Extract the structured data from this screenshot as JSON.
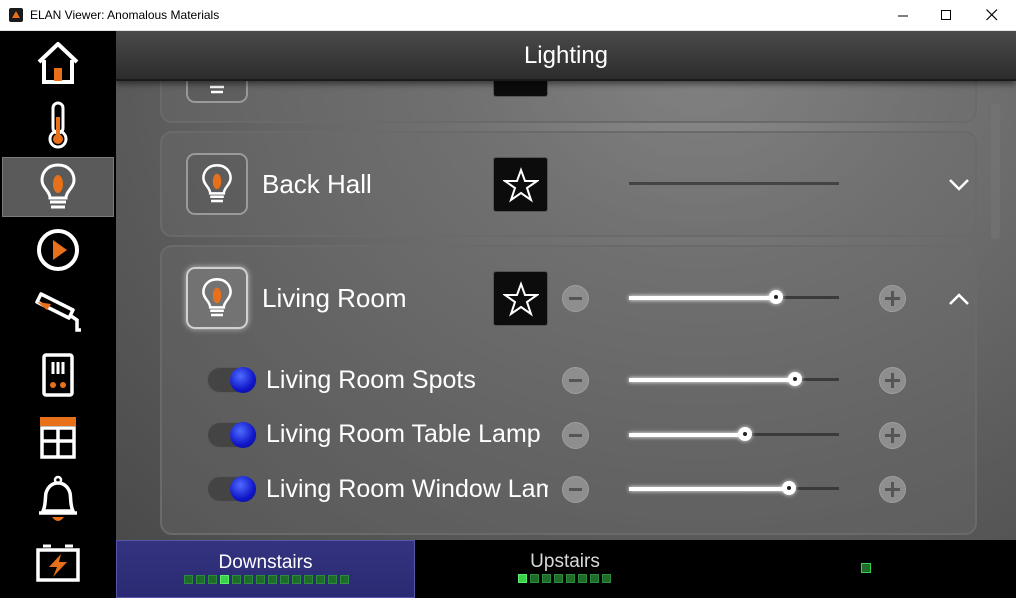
{
  "window": {
    "title": "ELAN Viewer: Anomalous Materials"
  },
  "sidebar": {
    "items": [
      {
        "name": "home-icon"
      },
      {
        "name": "thermometer-icon"
      },
      {
        "name": "lightbulb-icon",
        "active": true
      },
      {
        "name": "play-icon"
      },
      {
        "name": "security-camera-icon"
      },
      {
        "name": "intercom-icon"
      },
      {
        "name": "shades-icon"
      },
      {
        "name": "bell-icon"
      },
      {
        "name": "battery-icon"
      }
    ]
  },
  "header": {
    "title": "Lighting"
  },
  "rooms": [
    {
      "name": "Back Hall",
      "level": null,
      "expanded": false
    },
    {
      "name": "Living Room",
      "level": 0.7,
      "expanded": true
    }
  ],
  "loads": [
    {
      "name": "Living Room Spots",
      "level": 0.79,
      "on": true
    },
    {
      "name": "Living Room Table Lamp",
      "level": 0.55,
      "on": true
    },
    {
      "name": "Living Room Window Lamp",
      "level": 0.76,
      "on": true
    }
  ],
  "floors": [
    {
      "label": "Downstairs",
      "active": true
    },
    {
      "label": "Upstairs",
      "active": false
    }
  ],
  "colors": {
    "accent": "#e8701a",
    "active_floor": "#2a2a73",
    "indicator_on": "#3bd14b",
    "knob": "#1016c8"
  }
}
